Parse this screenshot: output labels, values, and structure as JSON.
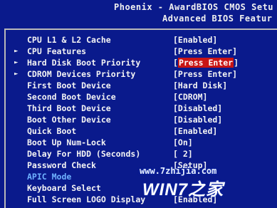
{
  "header": {
    "line1": "Phoenix - AwardBIOS CMOS Setu",
    "line2": "Advanced BIOS Featur"
  },
  "items": [
    {
      "label": "CPU L1 & L2 Cache",
      "value": "[Enabled]",
      "submenu": false
    },
    {
      "label": "CPU Features",
      "value": "[Press Enter]",
      "submenu": true
    },
    {
      "label": "Hard Disk Boot Priority",
      "value_prefix": "[",
      "value_hl": "Press Enter",
      "value_suffix": "]",
      "submenu": true,
      "selected": true
    },
    {
      "label": "CDROM Devices Priority",
      "value": "[Press Enter]",
      "submenu": true
    },
    {
      "label": "First Boot Device",
      "value": "[Hard Disk]",
      "submenu": false
    },
    {
      "label": "Second Boot Device",
      "value": "[CDROM]",
      "submenu": false
    },
    {
      "label": "Third Boot Device",
      "value": "[Disabled]",
      "submenu": false
    },
    {
      "label": "Boot Other Device",
      "value": "[Disabled]",
      "submenu": false
    },
    {
      "label": "Quick Boot",
      "value": "[Enabled]",
      "submenu": false
    },
    {
      "label": "Boot Up Num-Lock",
      "value": "[On]",
      "submenu": false
    },
    {
      "label": "Delay For HDD (Seconds)",
      "value": "[ 2]",
      "submenu": false
    },
    {
      "label": "Password Check",
      "value": "[Setup]",
      "submenu": false
    },
    {
      "label": "APIC Mode",
      "value": "",
      "submenu": false,
      "dim": true
    },
    {
      "label": "Keyboard Select",
      "value": "",
      "submenu": false
    },
    {
      "label": "Full Screen LOGO Display",
      "value": "[Enabled]",
      "submenu": false
    }
  ],
  "watermark": {
    "url": "www.7zhijia.com",
    "logo": "WIN7之家"
  }
}
